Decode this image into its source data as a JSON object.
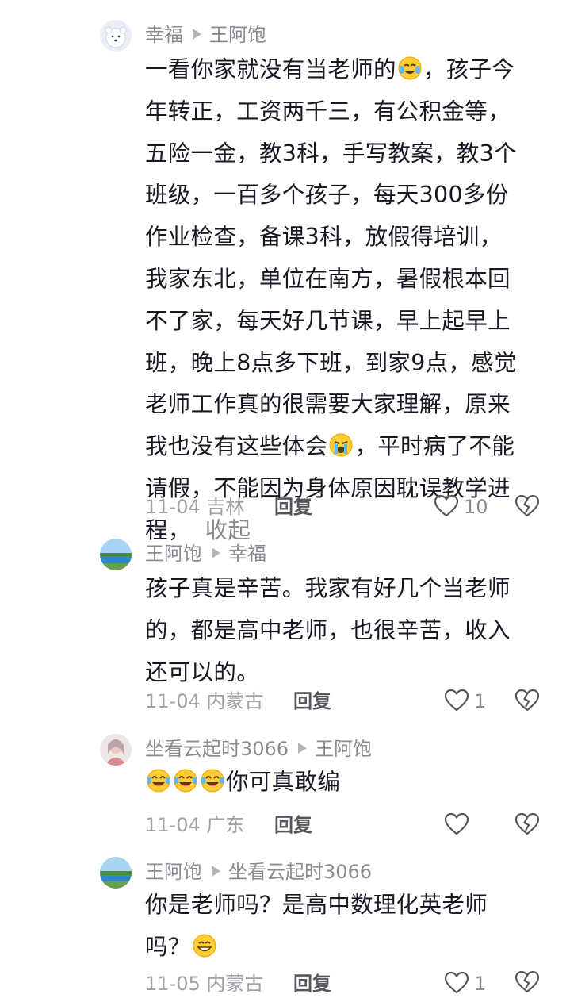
{
  "comments": [
    {
      "author": "幸福",
      "reply_to": "王阿饱",
      "avatar": "polar-bear-avatar",
      "lines": [
        [
          "一看你家就没有当老师的",
          "[emoji:laugh-cry]",
          "，孩子今"
        ],
        [
          "年转正，工资两千三，有公积金等，"
        ],
        [
          "五险一金，教3科，手写教案，教3个"
        ],
        [
          "班级，一百多个孩子，每天300多份"
        ],
        [
          "作业检查，备课3科，放假得培训，"
        ],
        [
          "我家东北，单位在南方，暑假根本回"
        ],
        [
          "不了家，每天好几节课，早上起早上"
        ],
        [
          "班，晚上8点多下班，到家9点，感觉"
        ],
        [
          "老师工作真的很需要大家理解，原来"
        ],
        [
          "我也没有这些体会",
          "[emoji:loudly-crying]",
          "，平时病了不能"
        ],
        [
          "请假，不能因为身体原因耽误教学进"
        ],
        [
          "程，"
        ]
      ],
      "collapse_label": "收起",
      "date": "11-04",
      "location": "吉林",
      "reply_label": "回复",
      "likes": "10"
    },
    {
      "author": "王阿饱",
      "reply_to": "幸福",
      "avatar": "lake-landscape-avatar",
      "lines": [
        [
          "孩子真是辛苦。我家有好几个当老师"
        ],
        [
          "的，都是高中老师，也很辛苦，收入"
        ],
        [
          "还可以的。"
        ]
      ],
      "date": "11-04",
      "location": "内蒙古",
      "reply_label": "回复",
      "likes": "1"
    },
    {
      "author": "坐看云起时3066",
      "reply_to": "王阿饱",
      "avatar": "portrait-avatar",
      "lines": [
        [
          "[emoji:tears-of-joy]",
          "[emoji:tears-of-joy]",
          "[emoji:tears-of-joy]",
          "你可真敢编"
        ]
      ],
      "date": "11-04",
      "location": "广东",
      "reply_label": "回复",
      "likes": ""
    },
    {
      "author": "王阿饱",
      "reply_to": "坐看云起时3066",
      "avatar": "lake-landscape-avatar",
      "lines": [
        [
          "你是老师吗？是高中数理化英老师"
        ],
        [
          "吗？",
          "[emoji:grinning]"
        ]
      ],
      "date": "11-05",
      "location": "内蒙古",
      "reply_label": "回复",
      "likes": "1"
    }
  ],
  "icons": {
    "arrow": "reply-arrow-icon",
    "like": "heart-outline-icon",
    "dislike": "broken-heart-icon"
  },
  "colors": {
    "text": "#161823",
    "muted": "#8a8b91",
    "reply": "#55565c"
  }
}
